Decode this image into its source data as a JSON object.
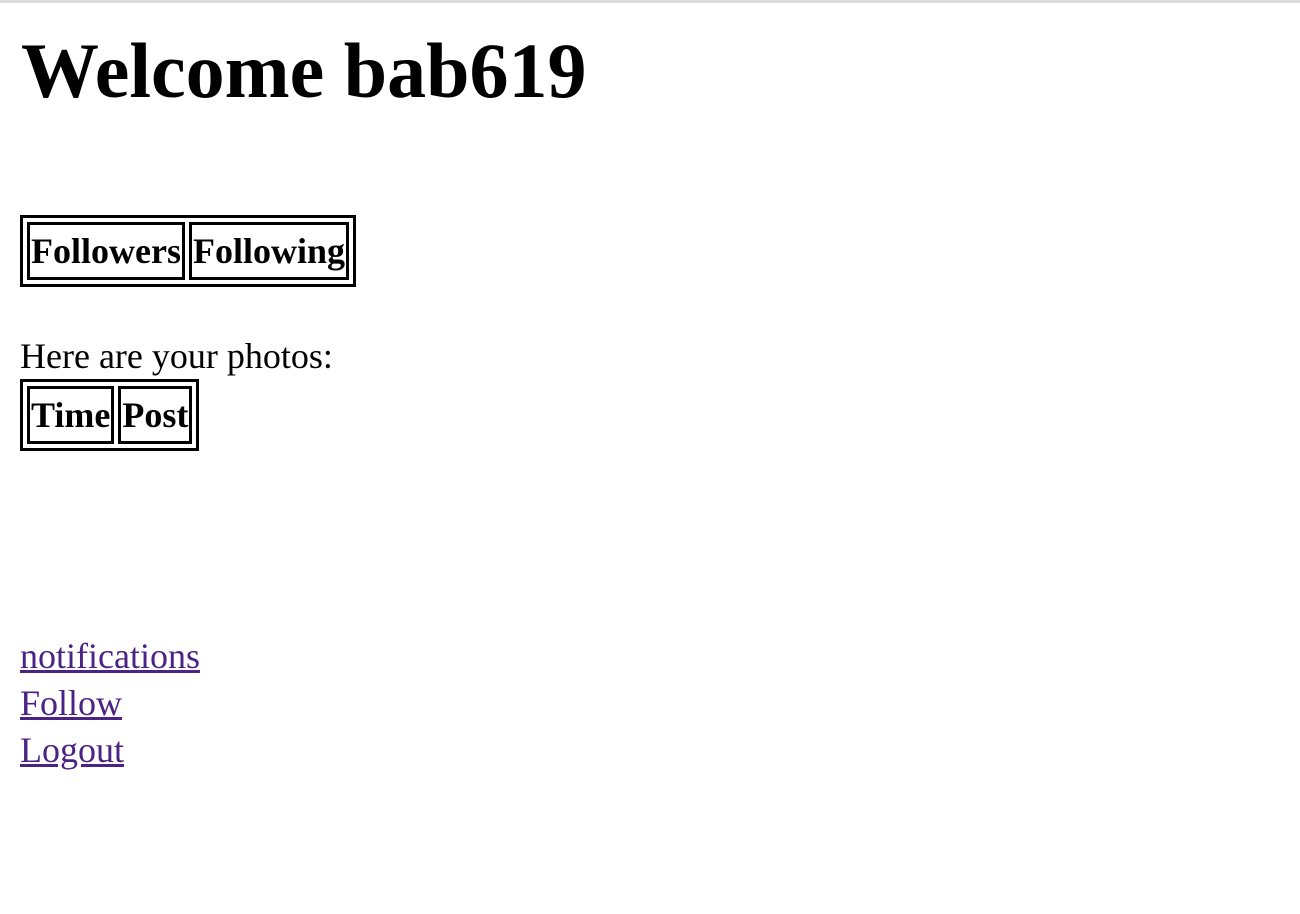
{
  "header": {
    "title": "Welcome bab619"
  },
  "social_table": {
    "headers": [
      "Followers",
      "Following"
    ]
  },
  "photos": {
    "intro": "Here are your photos:",
    "headers": [
      "Time",
      "Post"
    ]
  },
  "links": {
    "notifications": "notifications",
    "follow": "Follow",
    "logout": "Logout"
  },
  "colors": {
    "link_visited": "#4b2384",
    "text": "#000000",
    "background": "#ffffff"
  }
}
